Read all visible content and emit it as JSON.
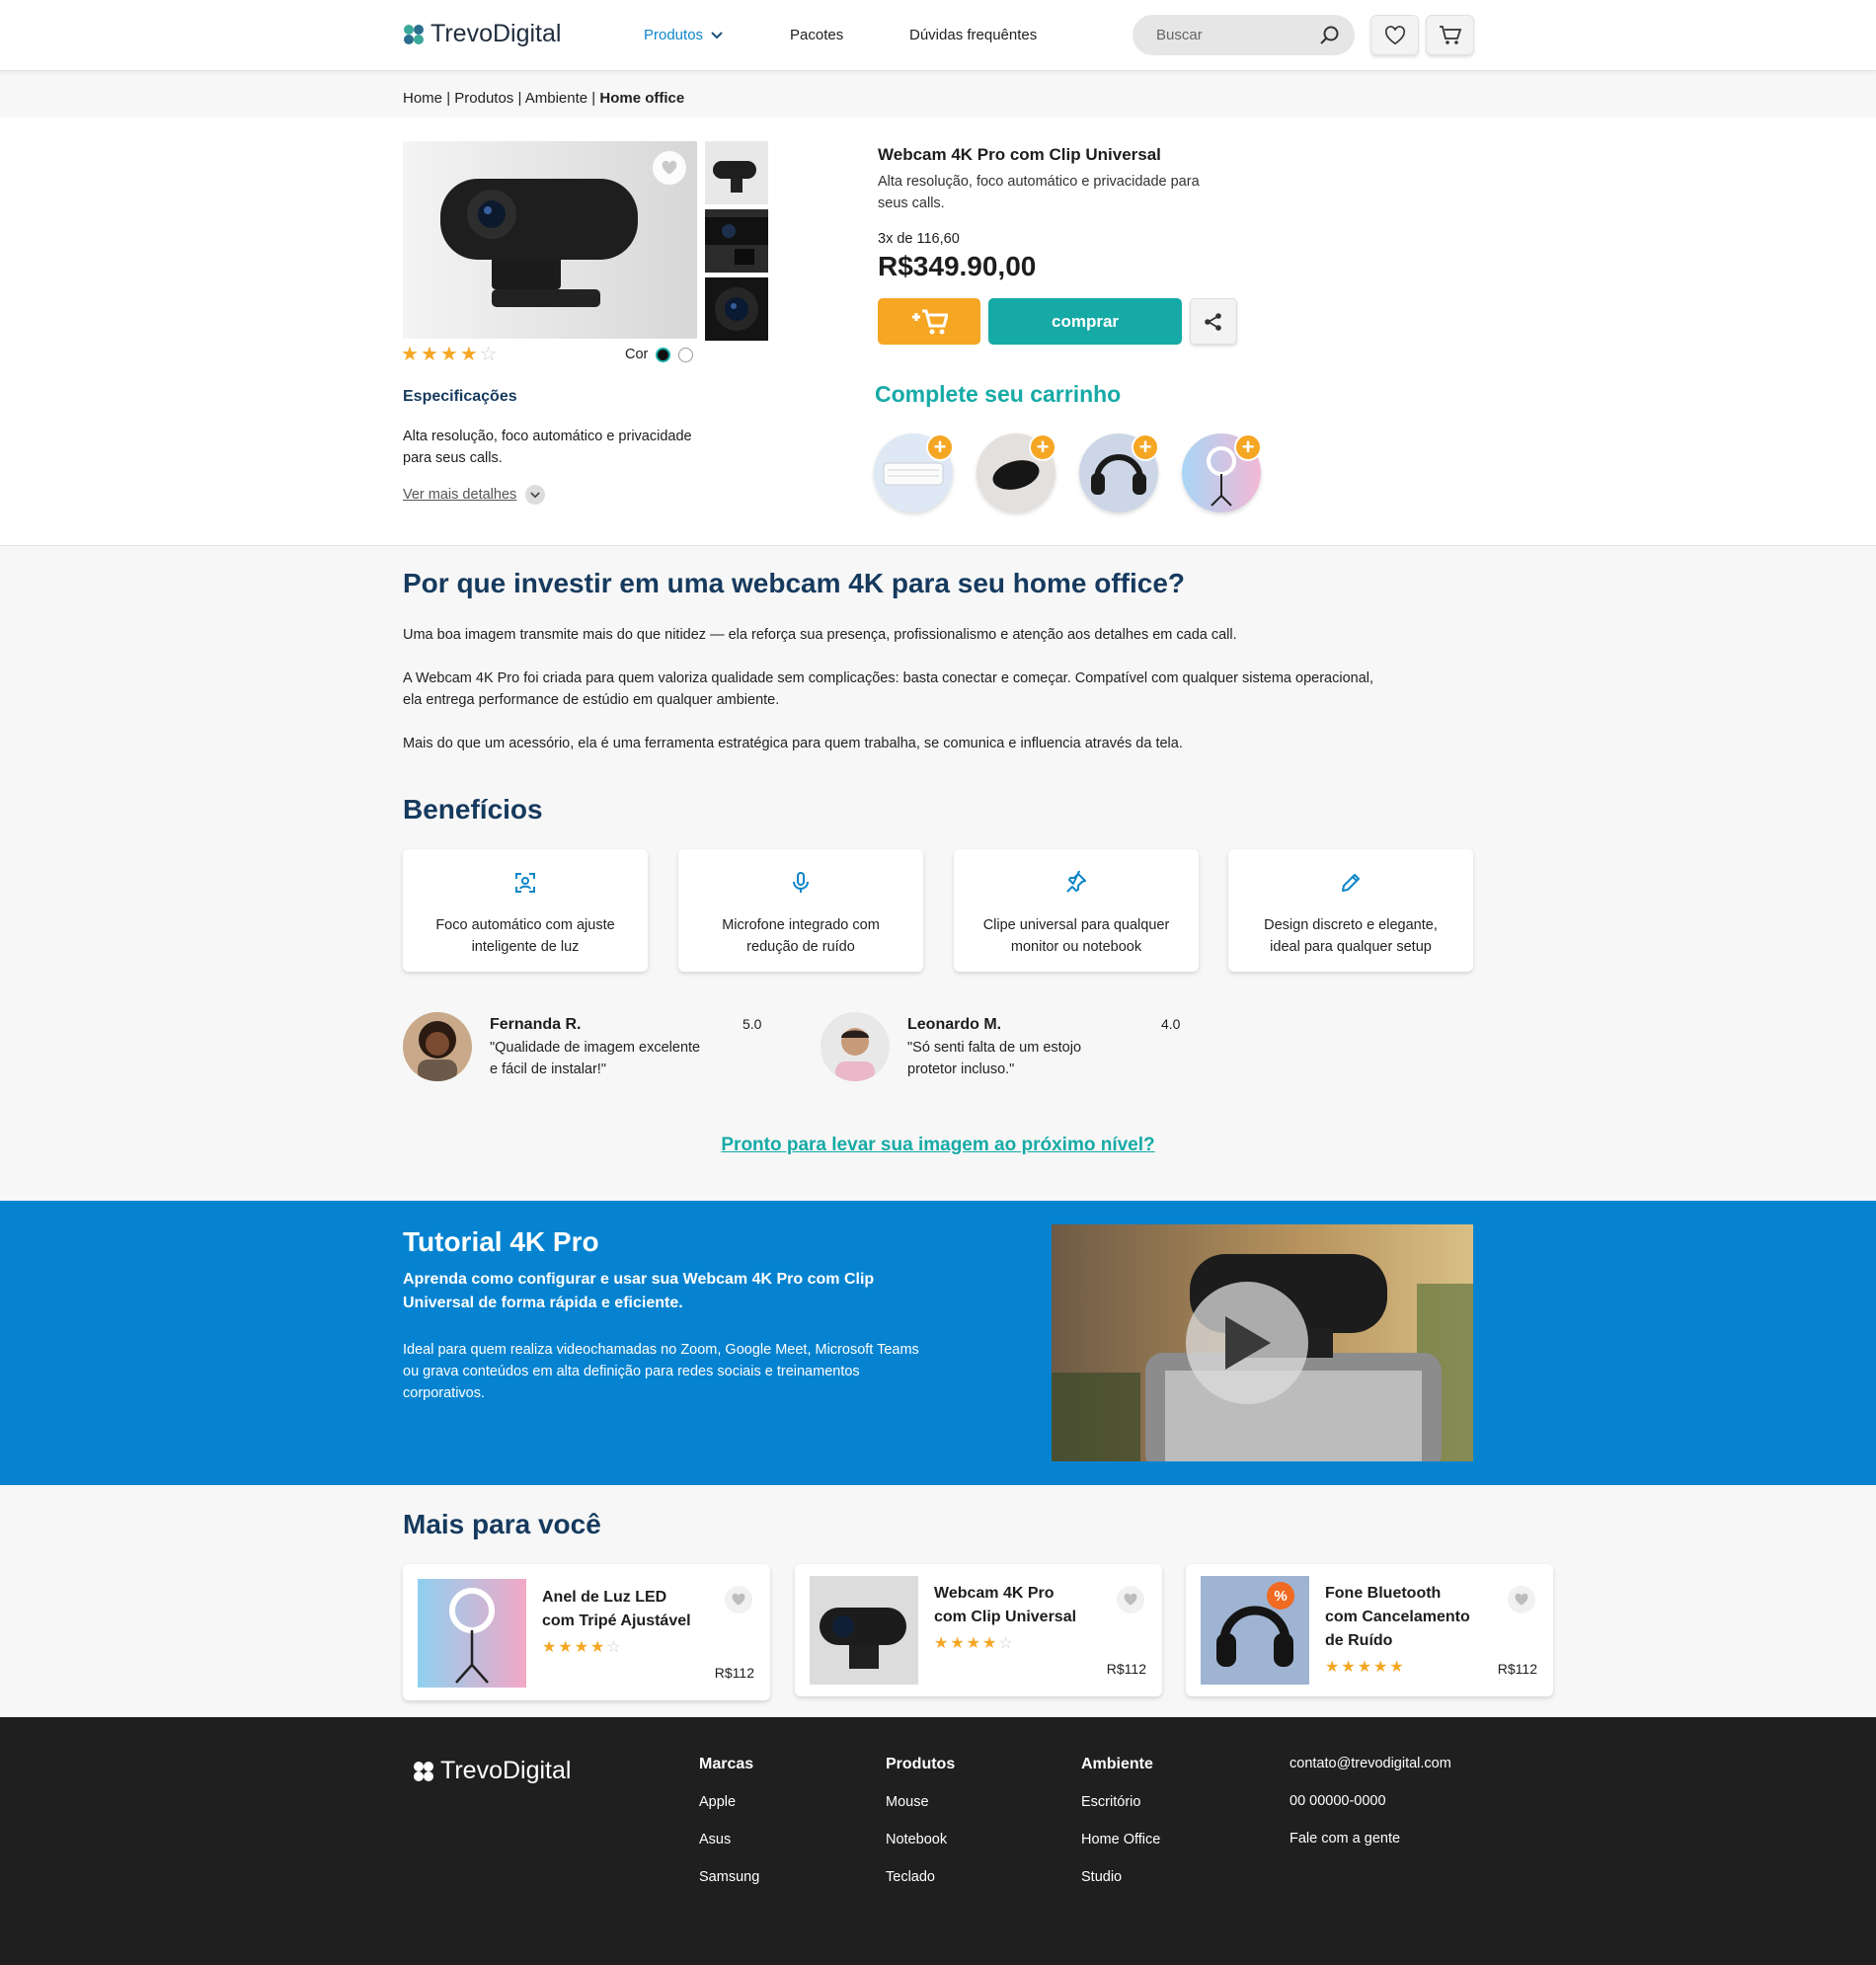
{
  "header": {
    "brand": "TrevoDigital",
    "nav": [
      {
        "label": "Produtos"
      },
      {
        "label": "Pacotes"
      },
      {
        "label": "Dúvidas frequêntes"
      }
    ],
    "search_placeholder": "Buscar"
  },
  "breadcrumb": {
    "items": [
      "Home",
      "Produtos",
      "Ambiente"
    ],
    "current": "Home office",
    "separator": "|"
  },
  "product": {
    "title": "Webcam 4K Pro com Clip Universal",
    "subtitle_line1": "Alta resolução, foco automático e privacidade para",
    "subtitle_line2": "seus calls.",
    "installments": "3x de 116,60",
    "price": "R$349.90,00",
    "rating": 4,
    "rating_max": 5,
    "color_label": "Cor",
    "buy_label": "comprar",
    "specs_title": "Especificações",
    "specs_line1": "Alta resolução, foco automático e privacidade",
    "specs_line2": "para seus calls.",
    "more_details": "Ver mais detalhes"
  },
  "complete_cart": {
    "title": "Complete seu carrinho",
    "items": [
      "keyboard",
      "mouse",
      "headphones",
      "ring-light"
    ]
  },
  "article": {
    "title": "Por que investir em uma webcam 4K para seu home office?",
    "p1": "Uma boa imagem transmite mais do que nitidez — ela reforça sua presença, profissionalismo e atenção aos detalhes em cada call.",
    "p2a": "A Webcam 4K Pro foi criada para quem valoriza qualidade sem complicações: basta conectar e começar. Compatível com qualquer sistema operacional,",
    "p2b": "ela entrega performance de estúdio em qualquer ambiente.",
    "p3": "Mais do que um acessório, ela é uma ferramenta estratégica para quem trabalha, se comunica e influencia através da tela."
  },
  "benefits": {
    "title": "Benefícios",
    "items": [
      {
        "icon": "face-focus-icon",
        "line1": "Foco automático com ajuste",
        "line2": "inteligente de luz"
      },
      {
        "icon": "microphone-icon",
        "line1": "Microfone integrado com",
        "line2": "redução de ruído"
      },
      {
        "icon": "pin-icon",
        "line1": "Clipe universal para qualquer",
        "line2": "monitor ou notebook"
      },
      {
        "icon": "pencil-icon",
        "line1": "Design discreto e elegante,",
        "line2": "ideal para qualquer setup"
      }
    ]
  },
  "reviews": [
    {
      "name": "Fernanda R.",
      "score": "5.0",
      "line1": "\"Qualidade de imagem excelente",
      "line2": "e fácil de instalar!\""
    },
    {
      "name": "Leonardo M.",
      "score": "4.0",
      "line1": "\"Só senti falta de um estojo",
      "line2": "protetor incluso.\""
    }
  ],
  "cta": "Pronto para levar sua imagem ao próximo nível?",
  "tutorial": {
    "title": "Tutorial 4K Pro",
    "lead_line1": "Aprenda como configurar e usar sua Webcam 4K Pro com Clip",
    "lead_line2": "Universal de forma rápida e eficiente.",
    "body_line1": "Ideal para quem realiza videochamadas no Zoom, Google Meet, Microsoft Teams",
    "body_line2": "ou grava conteúdos em alta definição para redes sociais e treinamentos",
    "body_line3": "corporativos."
  },
  "more": {
    "title": "Mais para você",
    "products": [
      {
        "line1": "Anel de Luz LED",
        "line2": "com Tripé Ajustável",
        "line3": "",
        "price": "R$112",
        "rating": 4
      },
      {
        "line1": "Webcam 4K Pro",
        "line2": "com Clip Universal",
        "line3": "",
        "price": "R$112",
        "rating": 4
      },
      {
        "line1": "Fone Bluetooth",
        "line2": "com Cancelamento",
        "line3": "de Ruído",
        "price": "R$112",
        "rating": 5
      }
    ]
  },
  "footer": {
    "brand": "TrevoDigital",
    "columns": [
      {
        "title": "Marcas",
        "links": [
          "Apple",
          "Asus",
          "Samsung"
        ]
      },
      {
        "title": "Produtos",
        "links": [
          "Mouse",
          "Notebook",
          "Teclado"
        ]
      },
      {
        "title": "Ambiente",
        "links": [
          "Escritório",
          "Home Office",
          "Studio"
        ]
      }
    ],
    "contact": [
      "contato@trevodigital.com",
      "00 00000-0000",
      "Fale com a gente"
    ]
  },
  "colors": {
    "accent_blue": "#0f86c9",
    "teal": "#16aaa6",
    "orange": "#f5a623",
    "navy": "#163a5e",
    "tutorial_bg": "#0583d0",
    "footer_bg": "#1f1f1f"
  }
}
